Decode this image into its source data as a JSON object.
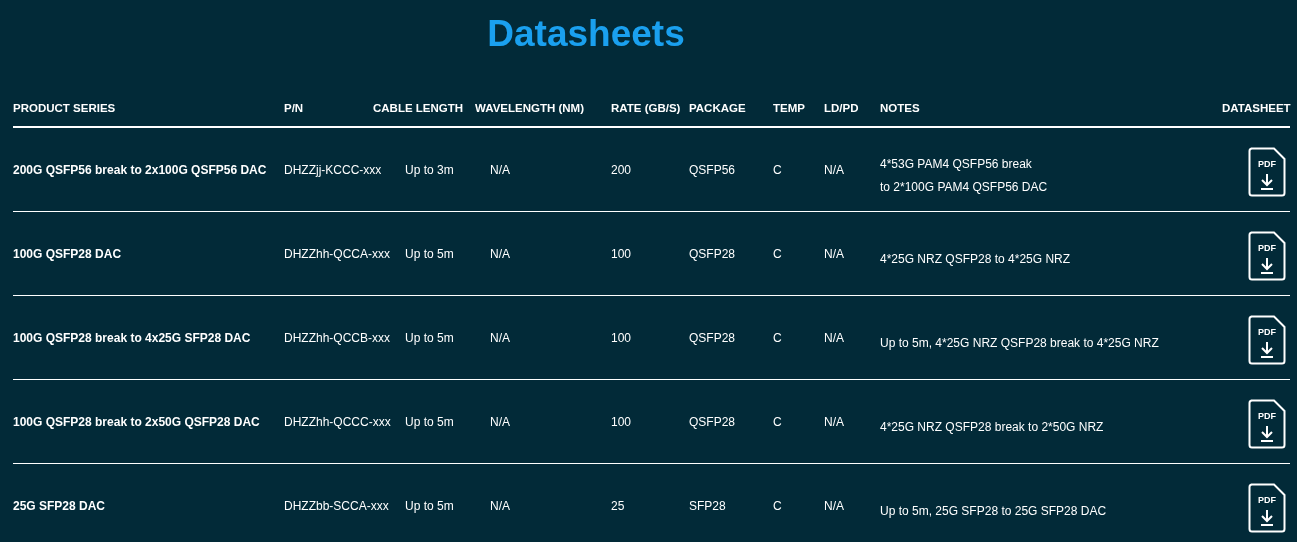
{
  "title": "Datasheets",
  "columns": [
    "PRODUCT SERIES",
    "P/N",
    "CABLE LENGTH",
    "WAVELENGTH (NM)",
    "RATE (GB/S)",
    "PACKAGE",
    "TEMP",
    "LD/PD",
    "NOTES",
    "DATASHEET"
  ],
  "rows": [
    {
      "series": "200G QSFP56 break to 2x100G QSFP56 DAC",
      "pn": "DHZZjj-KCCC-xxx",
      "length": "Up to 3m",
      "wavelength": "N/A",
      "rate": "200",
      "package": "QSFP56",
      "temp": "C",
      "ldpd": "N/A",
      "notes": [
        "4*53G PAM4 QSFP56 break",
        "to 2*100G PAM4 QSFP56 DAC"
      ],
      "datasheet": "PDF"
    },
    {
      "series": "100G QSFP28 DAC",
      "pn": "DHZZhh-QCCA-xxx",
      "length": "Up to 5m",
      "wavelength": "N/A",
      "rate": "100",
      "package": "QSFP28",
      "temp": "C",
      "ldpd": "N/A",
      "notes": [
        "4*25G NRZ QSFP28 to 4*25G NRZ"
      ],
      "datasheet": "PDF"
    },
    {
      "series": "100G QSFP28 break to 4x25G SFP28 DAC",
      "pn": "DHZZhh-QCCB-xxx",
      "length": "Up to 5m",
      "wavelength": "N/A",
      "rate": "100",
      "package": "QSFP28",
      "temp": "C",
      "ldpd": "N/A",
      "notes": [
        "Up to 5m, 4*25G NRZ QSFP28 break to 4*25G NRZ"
      ],
      "datasheet": "PDF"
    },
    {
      "series": "100G QSFP28 break to 2x50G QSFP28 DAC",
      "pn": "DHZZhh-QCCC-xxx",
      "length": "Up to 5m",
      "wavelength": "N/A",
      "rate": "100",
      "package": "QSFP28",
      "temp": "C",
      "ldpd": "N/A",
      "notes": [
        "4*25G NRZ QSFP28 break to 2*50G NRZ"
      ],
      "datasheet": "PDF"
    },
    {
      "series": "25G SFP28 DAC",
      "pn": "DHZZbb-SCCA-xxx",
      "length": "Up to 5m",
      "wavelength": "N/A",
      "rate": "25",
      "package": "SFP28",
      "temp": "C",
      "ldpd": "N/A",
      "notes": [
        "Up to 5m, 25G SFP28 to 25G SFP28 DAC"
      ],
      "datasheet": "PDF"
    }
  ]
}
